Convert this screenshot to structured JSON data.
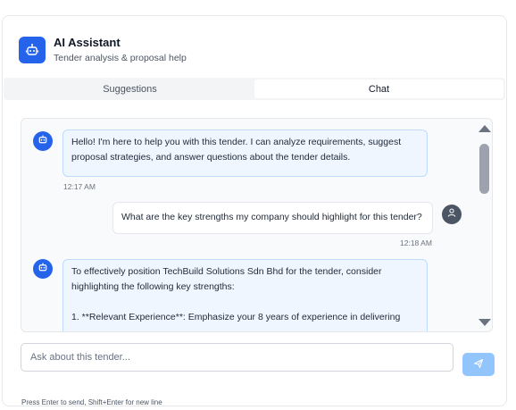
{
  "header": {
    "icon": "robot-icon",
    "title": "AI Assistant",
    "subtitle": "Tender analysis & proposal help"
  },
  "tabs": [
    {
      "label": "Suggestions",
      "active": false
    },
    {
      "label": "Chat",
      "active": true
    }
  ],
  "messages": [
    {
      "role": "assistant",
      "icon": "robot-icon",
      "lines": [
        "Hello! I'm here to help you with this tender. I can analyze requirements, suggest",
        "proposal strategies, and answer questions about the tender details."
      ],
      "time": "12:17 AM"
    },
    {
      "role": "user",
      "icon": "user-icon",
      "text": "What are the key strengths my company should highlight for this tender?",
      "time": "12:18 AM"
    },
    {
      "role": "assistant",
      "icon": "robot-icon",
      "lines": [
        "To effectively position TechBuild Solutions Sdn Bhd for the tender, consider",
        "highlighting the following key strengths:",
        "",
        "1. **Relevant Experience**: Emphasize your 8 years of experience in delivering"
      ]
    }
  ],
  "composer": {
    "placeholder": "Ask about this tender...",
    "value": "",
    "send_icon": "send-icon",
    "hint": "Press Enter to send, Shift+Enter for new line"
  },
  "colors": {
    "accent": "#2563eb",
    "send_disabled": "#93c5fd",
    "bot_bubble": "#eff6ff",
    "user_avatar": "#4b5563"
  }
}
